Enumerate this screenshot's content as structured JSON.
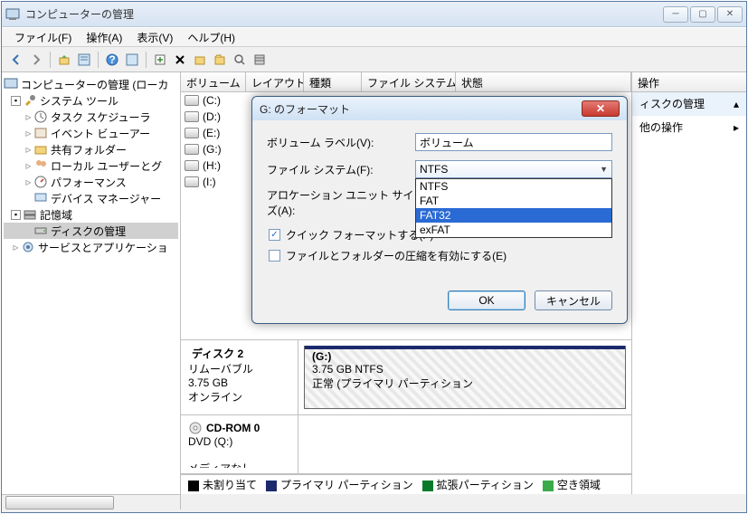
{
  "window": {
    "title": "コンピューターの管理"
  },
  "menu": {
    "file": "ファイル(F)",
    "action": "操作(A)",
    "view": "表示(V)",
    "help": "ヘルプ(H)"
  },
  "tree": {
    "root": "コンピューターの管理 (ローカ",
    "system_tools": "システム ツール",
    "task_scheduler": "タスク スケジューラ",
    "event_viewer": "イベント ビューアー",
    "shared_folders": "共有フォルダー",
    "local_users": "ローカル ユーザーとグ",
    "performance": "パフォーマンス",
    "device_manager": "デバイス マネージャー",
    "storage": "記憶域",
    "disk_management": "ディスクの管理",
    "services_apps": "サービスとアプリケーショ"
  },
  "list": {
    "col_volume": "ボリューム",
    "col_layout": "レイアウト",
    "col_type": "種類",
    "col_filesystem": "ファイル システム",
    "col_status": "状態",
    "vols": [
      "(C:)",
      "(D:)",
      "(E:)",
      "(G:)",
      "(H:)",
      "(I:)"
    ]
  },
  "disk": {
    "title": "ディスク 2",
    "removable": "リムーバブル",
    "size": "3.75 GB",
    "online": "オンライン",
    "part_label": "(G:)",
    "part_size": "3.75 GB NTFS",
    "part_status": "正常 (プライマリ パーティション",
    "cdrom_title": "CD-ROM 0",
    "cdrom_sub": "DVD (Q:)",
    "cdrom_media": "メディアなし"
  },
  "legend": {
    "unallocated": "未割り当て",
    "primary": "プライマリ パーティション",
    "ext": "拡張パーティション",
    "free": "空き領域"
  },
  "actions": {
    "header": "操作",
    "row1": "ィスクの管理",
    "row2": "他の操作"
  },
  "dialog": {
    "title": "G: のフォーマット",
    "volume_label_lbl": "ボリューム ラベル(V):",
    "volume_label_val": "ボリューム",
    "filesystem_lbl": "ファイル システム(F):",
    "filesystem_val": "NTFS",
    "allocation_lbl": "アロケーション ユニット サイズ(A):",
    "fs_options": [
      "NTFS",
      "FAT",
      "FAT32",
      "exFAT"
    ],
    "quick_format": "クイック フォーマットする(P)",
    "compress": "ファイルとフォルダーの圧縮を有効にする(E)",
    "ok": "OK",
    "cancel": "キャンセル"
  }
}
